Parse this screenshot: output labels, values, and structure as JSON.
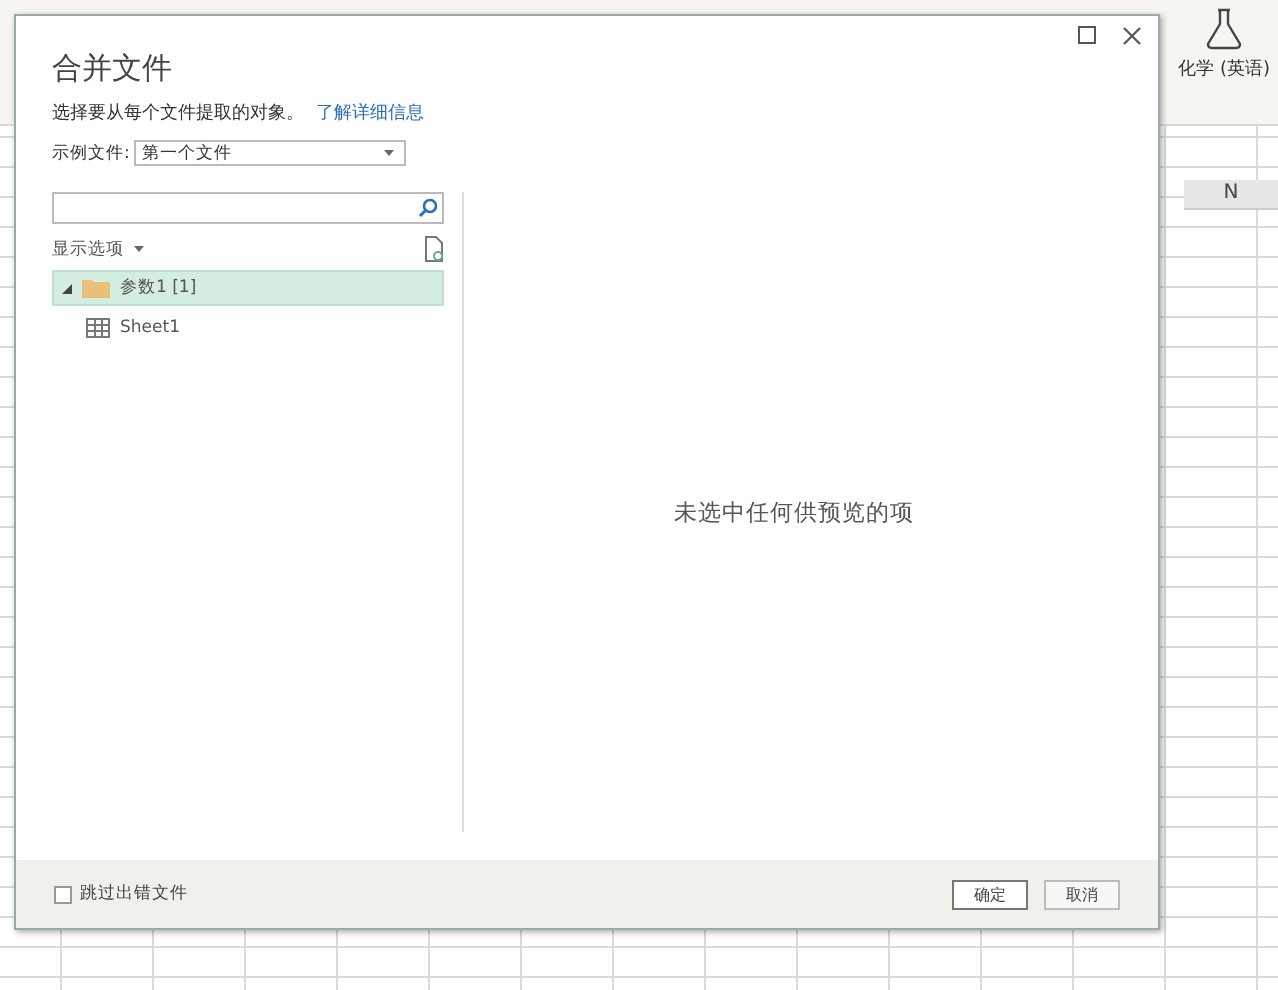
{
  "background_app": {
    "ribbon_button": {
      "label": "化学 (英语)"
    },
    "column_header": "N"
  },
  "dialog": {
    "title": "合并文件",
    "subtitle": "选择要从每个文件提取的对象。",
    "learn_more_link": "了解详细信息",
    "sample_file": {
      "label": "示例文件:",
      "value": "第一个文件"
    },
    "display_options": "显示选项",
    "tree": [
      {
        "label": "参数1 [1]",
        "kind": "folder",
        "selected": true,
        "expanded": true,
        "children": [
          {
            "label": "Sheet1",
            "kind": "sheet",
            "selected": false
          }
        ]
      }
    ],
    "preview_message": "未选中任何供预览的项",
    "skip_errors": {
      "label": "跳过出错文件",
      "checked": false
    },
    "buttons": [
      {
        "label": "确定",
        "kind": "primary"
      },
      {
        "label": "取消",
        "kind": "secondary"
      }
    ]
  }
}
